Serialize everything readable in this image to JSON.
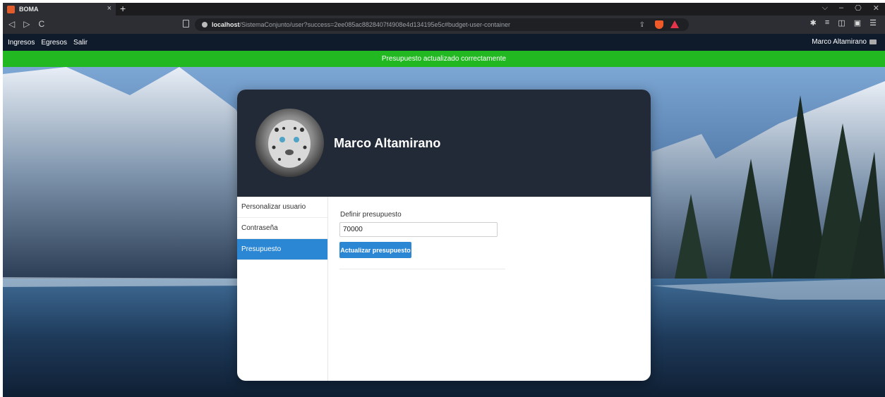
{
  "browser": {
    "tab_title": "BOMA",
    "tab_close": "×",
    "new_tab": "+",
    "url_host": "localhost",
    "url_path": "/SistemaConjunto/user?success=2ee085ac8828407f4908e4d134195e5c#budget-user-container",
    "nav": {
      "back": "◁",
      "forward": "▷",
      "reload": "C"
    },
    "window_controls": {
      "menu": "⌵",
      "minimize": "–",
      "restore": "⎔",
      "close": "✕"
    },
    "toolbar": {
      "extensions": "✱",
      "playlist": "≡",
      "sidebar": "◫",
      "wallet": "▣",
      "menu": "☰"
    }
  },
  "appnav": {
    "links": [
      "Ingresos",
      "Egresos",
      "Salir"
    ],
    "user_name": "Marco Altamirano"
  },
  "alert": {
    "message": "Presupuesto actualizado correctamente",
    "color": "#22b822"
  },
  "profile": {
    "name": "Marco Altamirano",
    "avatar_icon": "snow-leopard-avatar"
  },
  "sidebar": {
    "items": [
      {
        "label": "Personalizar usuario"
      },
      {
        "label": "Contraseña"
      },
      {
        "label": "Presupuesto"
      }
    ],
    "active_index": 2
  },
  "budget_form": {
    "label": "Definir presupuesto",
    "value": "70000",
    "button_label": "Actualizar presupuesto"
  },
  "colors": {
    "accent": "#2b86d4",
    "header_bg": "#222a37",
    "appnav_bg": "#0f1a2a"
  }
}
